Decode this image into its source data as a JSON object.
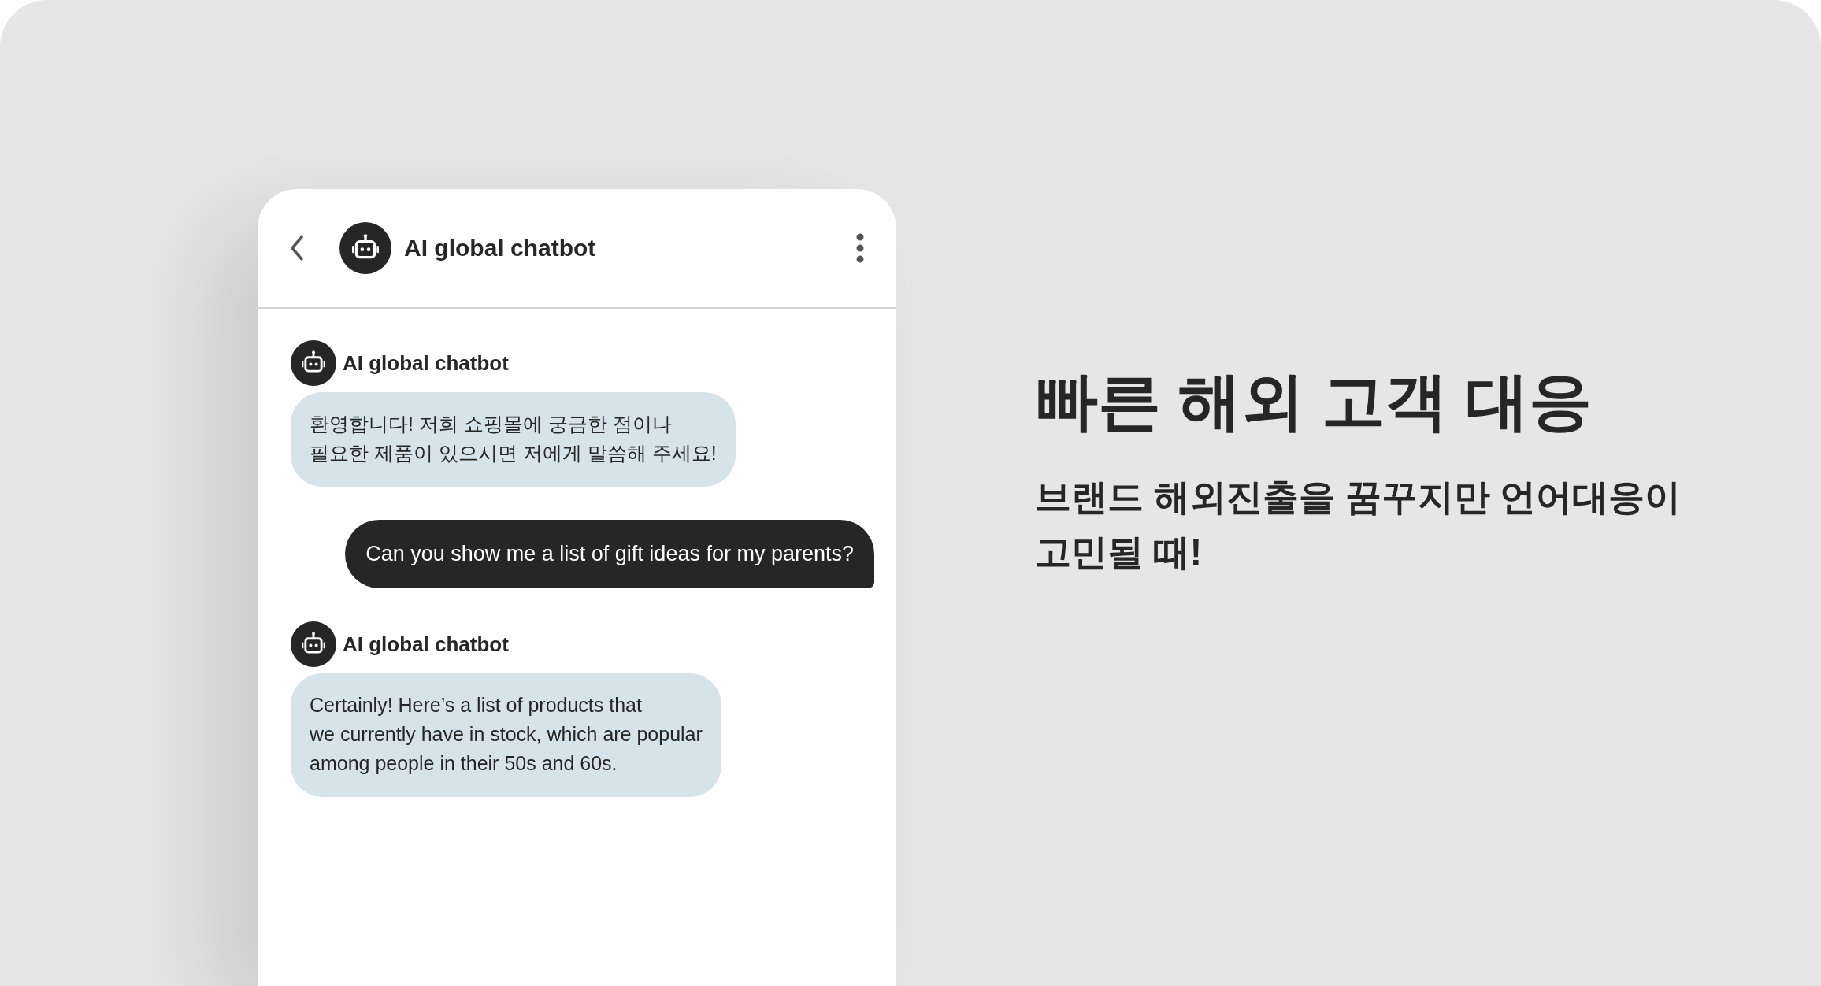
{
  "chat": {
    "header": {
      "title": "AI global chatbot"
    },
    "messages": [
      {
        "kind": "bot",
        "sender": "AI global chatbot",
        "text": "환영합니다! 저희 쇼핑몰에 궁금한 점이나\n필요한 제품이 있으시면 저에게 말씀해 주세요!"
      },
      {
        "kind": "user",
        "text": "Can you show me a list of gift ideas for my parents?"
      },
      {
        "kind": "bot",
        "sender": "AI global chatbot",
        "text": "Certainly! Here’s a list of products that\nwe currently have in stock, which are popular\namong people in their 50s and 60s."
      }
    ]
  },
  "feature": {
    "heading": "빠른 해외 고객 대응",
    "description": "브랜드 해외진출을 꿈꾸지만 언어대응이\n고민될 때!"
  }
}
